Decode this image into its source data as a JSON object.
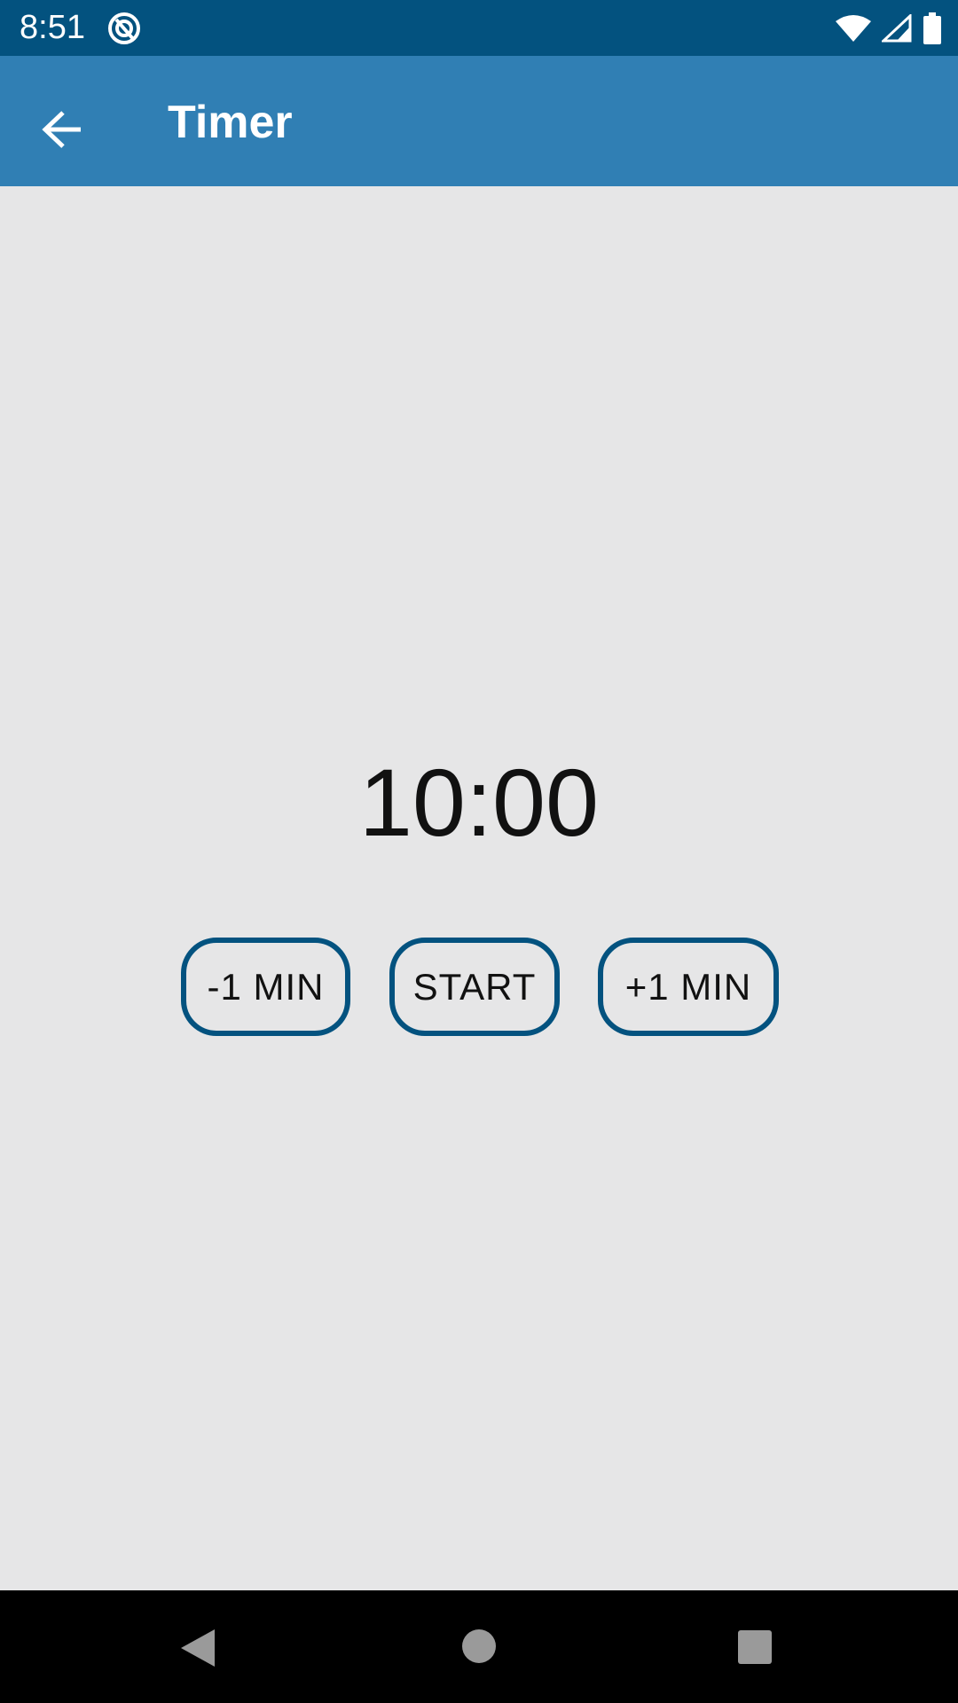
{
  "status_bar": {
    "time": "8:51",
    "app_icon": "vpn-shield-icon",
    "wifi_icon": "wifi-icon",
    "signal_icon": "cell-signal-icon",
    "battery_icon": "battery-icon",
    "background_color": "#03527f"
  },
  "app_bar": {
    "title": "Timer",
    "back_icon": "arrow-left-icon",
    "background_color": "#307fb4"
  },
  "timer": {
    "display": "10:00"
  },
  "controls": {
    "minus_label": "-1 MIN",
    "start_label": "START",
    "plus_label": "+1 MIN",
    "border_color": "#03527f"
  },
  "nav_bar": {
    "back_icon": "nav-back-triangle-icon",
    "home_icon": "nav-home-circle-icon",
    "recents_icon": "nav-recents-square-icon"
  }
}
